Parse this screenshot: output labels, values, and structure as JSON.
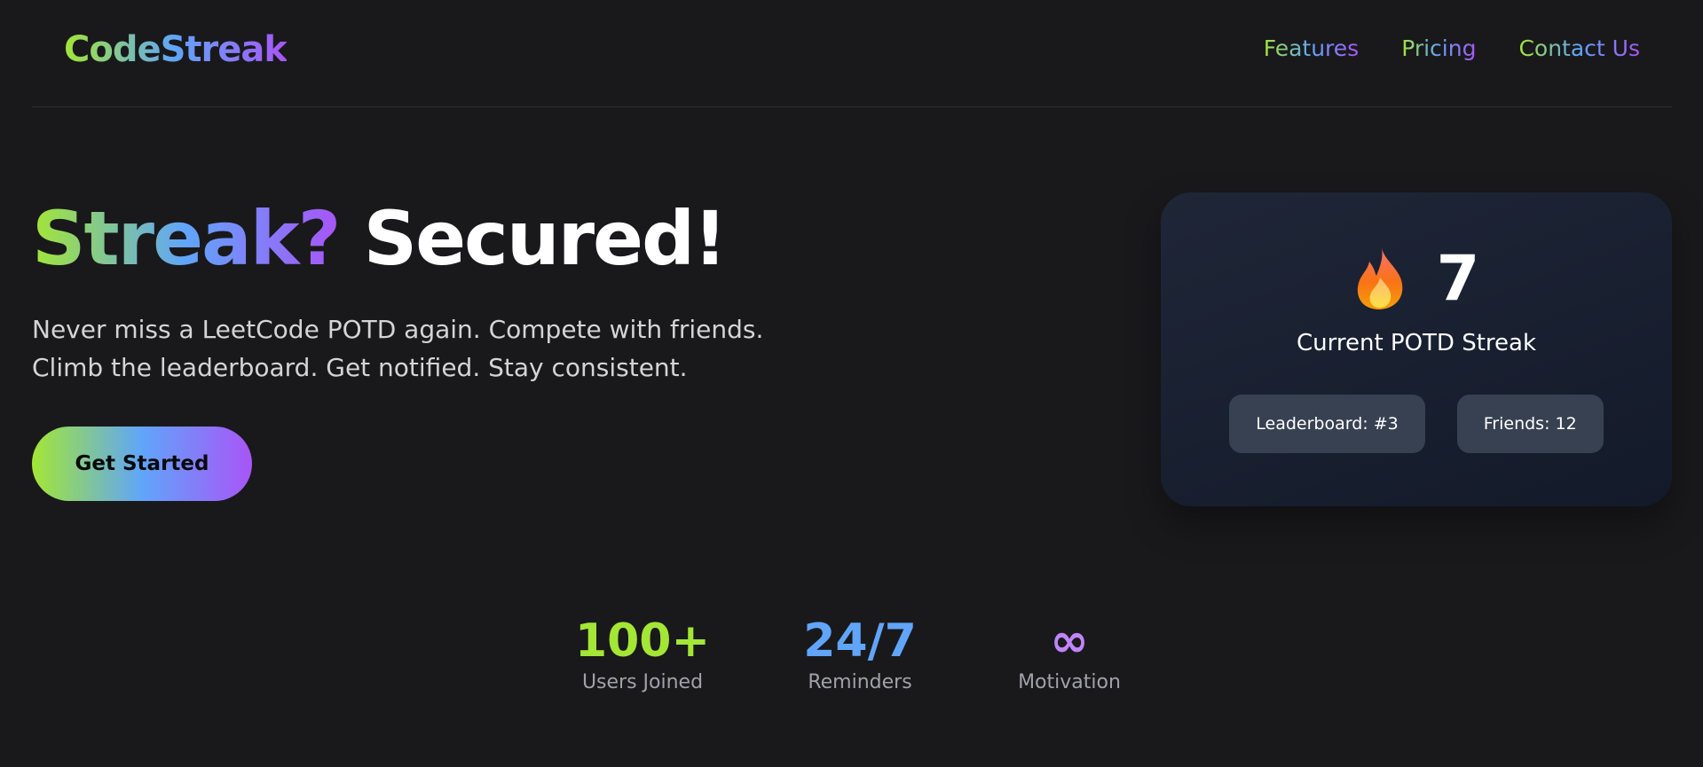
{
  "nav": {
    "logo": "CodeStreak",
    "links": [
      {
        "label": "Features"
      },
      {
        "label": "Pricing"
      },
      {
        "label": "Contact Us"
      }
    ]
  },
  "hero": {
    "title_highlight": "Streak?",
    "title_rest": " Secured!",
    "subtitle": "Never miss a LeetCode POTD again. Compete with friends. Climb the leaderboard. Get notified. Stay consistent.",
    "cta_label": "Get Started"
  },
  "card": {
    "icon": "flame-icon",
    "streak_value": "7",
    "streak_label": "Current POTD Streak",
    "chips": [
      {
        "label": "Leaderboard: #3"
      },
      {
        "label": "Friends: 12"
      }
    ]
  },
  "stats": [
    {
      "value": "100+",
      "label": "Users Joined",
      "color": "#a3e635"
    },
    {
      "value": "24/7",
      "label": "Reminders",
      "color": "#60a5fa"
    },
    {
      "value": "∞",
      "label": "Motivation",
      "color": "#c084fc"
    }
  ],
  "colors": {
    "background": "#19191b",
    "gradient_start": "#a3e635",
    "gradient_mid": "#60a5fa",
    "gradient_end": "#a855f7",
    "card_bg": "#1a2132",
    "chip_bg": "#374151"
  }
}
